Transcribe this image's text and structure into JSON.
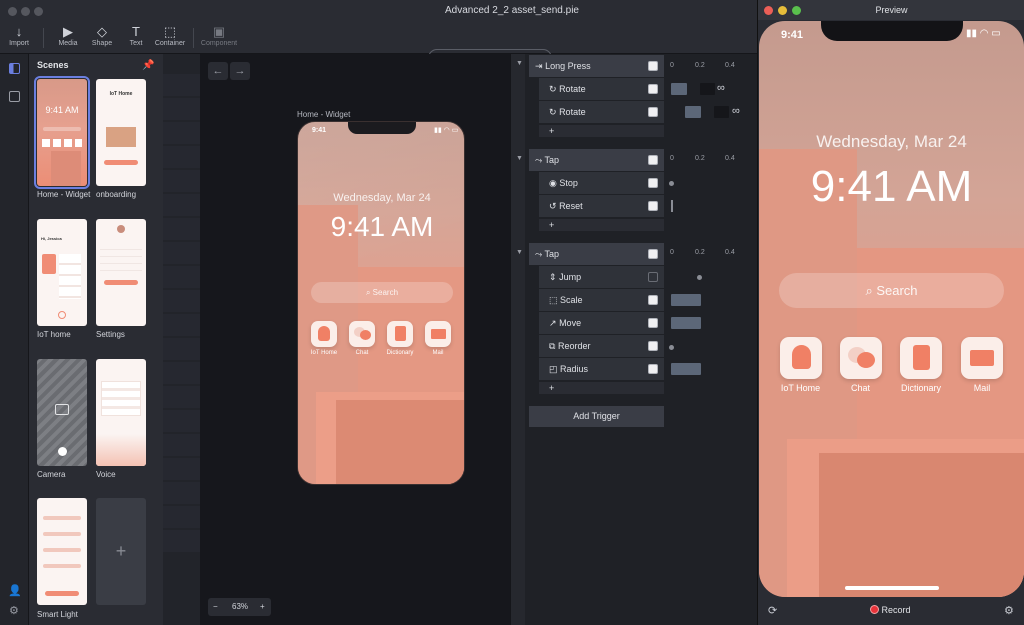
{
  "window": {
    "title": "Advanced 2_2 asset_send.pie",
    "device": "iPhone 11 Pro / X  375 x 812"
  },
  "toolbar": [
    {
      "id": "import",
      "label": "Import",
      "icon": "↓"
    },
    {
      "id": "media",
      "label": "Media",
      "icon": "▶"
    },
    {
      "id": "shape",
      "label": "Shape",
      "icon": "◇"
    },
    {
      "id": "text",
      "label": "Text",
      "icon": "T"
    },
    {
      "id": "container",
      "label": "Container",
      "icon": "⬚"
    },
    {
      "id": "component",
      "label": "Component",
      "icon": "▣"
    }
  ],
  "scenes": {
    "title": "Scenes",
    "items": [
      {
        "label": "Home - Widget"
      },
      {
        "label": "onboarding"
      },
      {
        "label": "IoT home"
      },
      {
        "label": "Settings"
      },
      {
        "label": "Camera"
      },
      {
        "label": "Voice"
      },
      {
        "label": "Smart Light"
      }
    ],
    "thumbs": {
      "home_time": "9:41 AM",
      "onboarding_title": "IoT Home",
      "iot_greeting": "Hi, Jessica"
    }
  },
  "canvas": {
    "artboard_label": "Home - Widget",
    "status_time": "9:41",
    "date": "Wednesday, Mar 24",
    "time": "9:41 AM",
    "search_placeholder": "Search",
    "apps": [
      "IoT Home",
      "Chat",
      "Dictionary",
      "Mail"
    ],
    "zoom": "63%"
  },
  "timeline": {
    "ruler": [
      "0",
      "0.2",
      "0.4"
    ],
    "groups": [
      {
        "trigger": "Long Press",
        "responses": [
          "Rotate",
          "Rotate"
        ]
      },
      {
        "trigger": "Tap",
        "responses": [
          "Stop",
          "Reset"
        ]
      },
      {
        "trigger": "Tap",
        "responses": [
          "Jump",
          "Scale",
          "Move",
          "Reorder",
          "Radius"
        ]
      }
    ],
    "plus": "+",
    "add_trigger": "Add Trigger",
    "infinity": "∞"
  },
  "preview": {
    "title": "Preview",
    "status_time": "9:41",
    "date": "Wednesday, Mar 24",
    "time": "9:41 AM",
    "search_placeholder": "Search",
    "apps": [
      "IoT Home",
      "Chat",
      "Dictionary",
      "Mail"
    ],
    "record": "Record"
  },
  "colors": {
    "accent": "#6b7fe0",
    "record": "#e8333a",
    "tile": "#fbeee9",
    "scene_bg": "#e6a08f"
  }
}
